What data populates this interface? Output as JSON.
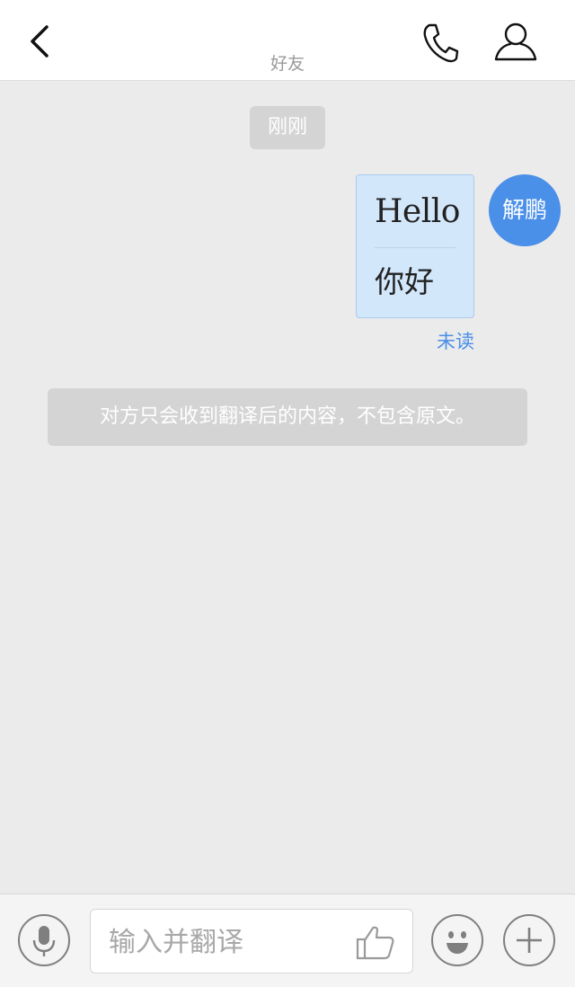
{
  "header": {
    "title": "好友",
    "back_icon": "chevron-left-icon",
    "call_icon": "phone-icon",
    "profile_icon": "user-icon"
  },
  "chat": {
    "timestamp": "刚刚",
    "message": {
      "original": "Hello",
      "translated": "你好",
      "status": "未读"
    },
    "sender_avatar_name": "解鹏",
    "notice": "对方只会收到翻译后的内容，不包含原文。"
  },
  "input_bar": {
    "placeholder": "输入并翻译",
    "mic_icon": "microphone-icon",
    "like_icon": "thumbs-up-icon",
    "emoji_icon": "smiley-icon",
    "plus_icon": "plus-icon"
  },
  "colors": {
    "accent": "#4a8fe8",
    "bubble": "#d3e7fb",
    "background": "#ebebeb"
  }
}
